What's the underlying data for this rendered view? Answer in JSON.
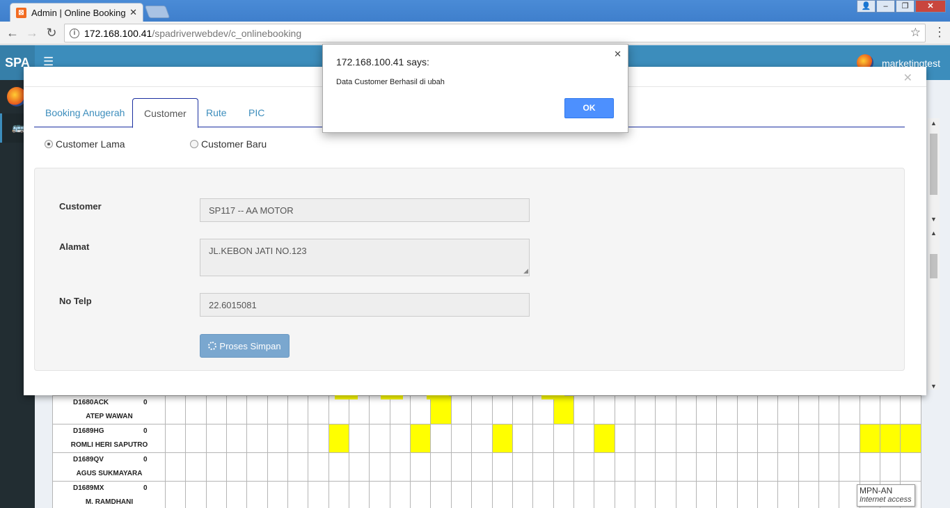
{
  "browser": {
    "tab_title": "Admin | Online Booking",
    "tab_close": "✕",
    "url_host": "172.168.100.41",
    "url_path": "/spadriverwebdev/c_onlinebooking"
  },
  "app": {
    "logo": "SPA",
    "user_name": "marketingtest"
  },
  "alert": {
    "title": "172.168.100.41 says:",
    "message": "Data Customer Berhasil di ubah",
    "ok_label": "OK"
  },
  "modal": {
    "tabs": [
      "Booking Anugerah",
      "Customer",
      "Rute",
      "PIC"
    ],
    "active_tab": "Customer",
    "radio_options": [
      "Customer Lama",
      "Customer Baru"
    ],
    "selected_radio": "Customer Lama",
    "form": {
      "customer_label": "Customer",
      "customer_value": "SP117 -- AA MOTOR",
      "alamat_label": "Alamat",
      "alamat_value": "JL.KEBON JATI NO.123",
      "telp_label": "No Telp",
      "telp_value": "22.6015081",
      "save_label": "Proses Simpan"
    }
  },
  "schedule": {
    "rows": [
      {
        "code": "D1680ACK",
        "count": "0",
        "name": "ATEP WAWAN",
        "yellow": [
          13,
          19
        ]
      },
      {
        "code": "D1689HG",
        "count": "0",
        "name": "ROMLI HERI SAPUTRO",
        "yellow": [
          8,
          12,
          16,
          21,
          34,
          35,
          36
        ]
      },
      {
        "code": "D1689QV",
        "count": "0",
        "name": "AGUS SUKMAYARA",
        "yellow": []
      },
      {
        "code": "D1689MX",
        "count": "0",
        "name": "M. RAMDHANI",
        "yellow": []
      }
    ]
  },
  "tooltip": {
    "line1": "MPN-AN",
    "line2": "Internet access"
  },
  "colors": {
    "header": "#3c8dbc",
    "sidebar": "#222d32",
    "highlight": "#ffff00",
    "ok_button": "#4d90fe"
  }
}
